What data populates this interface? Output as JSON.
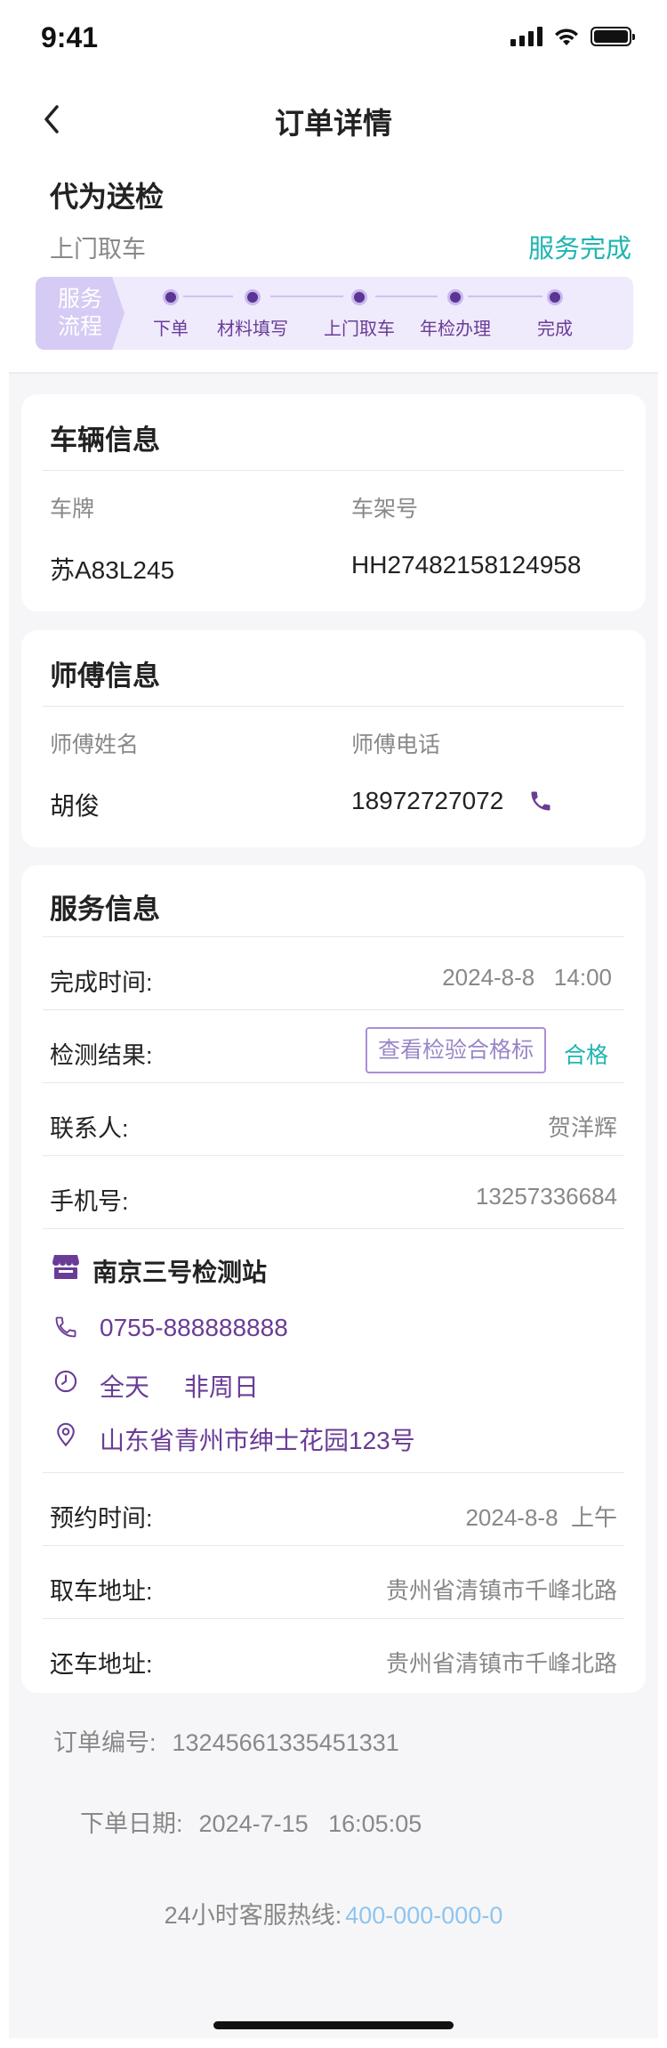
{
  "status_bar": {
    "time": "9:41"
  },
  "nav": {
    "title": "订单详情"
  },
  "service": {
    "title": "代为送检",
    "subtitle": "上门取车",
    "status": "服务完成",
    "flow_tag": "服务\n流程",
    "steps": [
      "下单",
      "材料填写",
      "上门取车",
      "年检办理",
      "完成"
    ]
  },
  "vehicle": {
    "title": "车辆信息",
    "plate_label": "车牌",
    "plate_value": "苏A83L245",
    "vin_label": "车架号",
    "vin_value": "HH27482158124958"
  },
  "master": {
    "title": "师傅信息",
    "name_label": "师傅姓名",
    "name_value": "胡俊",
    "phone_label": "师傅电话",
    "phone_value": "18972727072"
  },
  "service_info": {
    "title": "服务信息",
    "finish_label": "完成时间:",
    "finish_value": "2024-8-8   14:00",
    "result_label": "检测结果:",
    "cert_button": "查看检验合格标",
    "result_value": "合格",
    "contact_label": "联系人:",
    "contact_value": "贺洋辉",
    "mobile_label": "手机号:",
    "mobile_value": "13257336684",
    "station": {
      "name": "南京三号检测站",
      "phone": "0755-888888888",
      "hours": "全天     非周日",
      "address": "山东省青州市绅士花园123号"
    },
    "appointment_label": "预约时间:",
    "appointment_value": "2024-8-8  上午",
    "pickup_label": "取车地址:",
    "pickup_value": "贵州省清镇市千峰北路",
    "return_label": "还车地址:",
    "return_value": "贵州省清镇市千峰北路"
  },
  "order": {
    "number_label": "订单编号:",
    "number_value": "13245661335451331",
    "date_label": "下单日期:",
    "date_value": "2024-7-15   16:05:05"
  },
  "hotline": {
    "label": "24小时客服热线:",
    "number": "400-000-000-0"
  },
  "colors": {
    "accent_purple": "#6a3c96",
    "status_teal": "#1fb4b2",
    "hotline_blue": "#8fc4ee"
  }
}
